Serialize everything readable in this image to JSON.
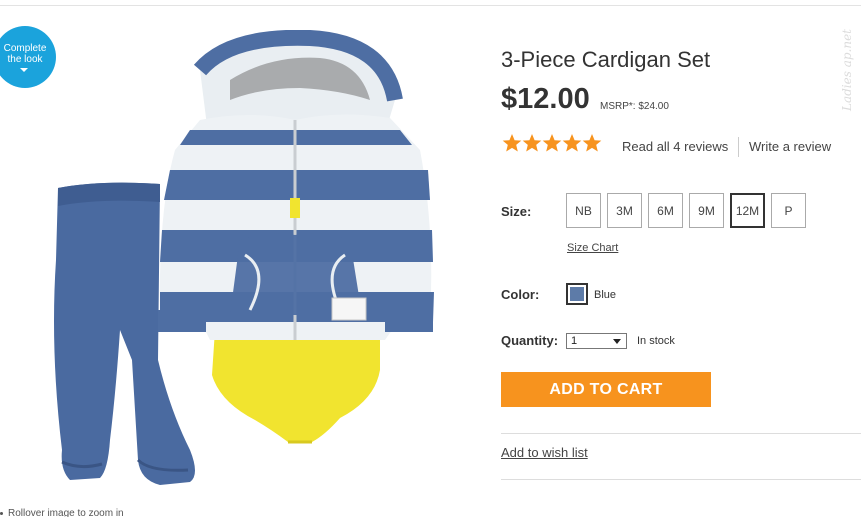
{
  "badge": {
    "label": "Complete the look"
  },
  "product": {
    "title": "3-Piece Cardigan Set",
    "price": "$12.00",
    "msrp": "MSRP*: $24.00",
    "rating": 5,
    "rating_max": 5,
    "reviews_link": "Read all 4 reviews",
    "write_review": "Write a review"
  },
  "size": {
    "label": "Size:",
    "options": [
      "NB",
      "3M",
      "6M",
      "9M",
      "12M",
      "P"
    ],
    "selected": "12M",
    "chart_link": "Size Chart"
  },
  "color": {
    "label": "Color:",
    "selected_name": "Blue",
    "swatch_hex": "#5d7ba8"
  },
  "quantity": {
    "label": "Quantity:",
    "value": "1",
    "stock": "In stock"
  },
  "actions": {
    "add_to_cart": "ADD TO CART",
    "wishlist": "Add to wish list"
  },
  "hint": {
    "rollover": "Rollover image to zoom in"
  },
  "watermark": {
    "text": "Ladies ap.net"
  },
  "colors": {
    "accent_orange": "#f7931e",
    "badge_blue": "#1ba3dc",
    "star_orange": "#f7931e"
  }
}
